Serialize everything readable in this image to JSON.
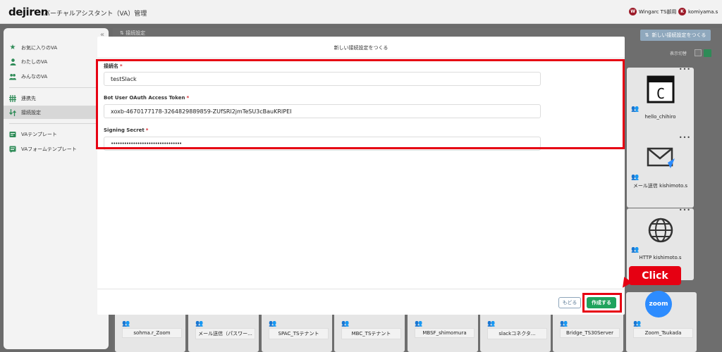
{
  "header": {
    "logo": "dejiren",
    "title": "バーチャルアシスタント（VA）管理",
    "tenant_badge": "W",
    "tenant_name": "Wingarc TS部用",
    "user_badge": "K",
    "user_name": "komiyama.s"
  },
  "sidebar": {
    "items": [
      {
        "label": "お気に入りのVA",
        "icon": "star-icon"
      },
      {
        "label": "わたしのVA",
        "icon": "person-icon"
      },
      {
        "label": "みんなのVA",
        "icon": "people-icon"
      },
      {
        "label": "連携先",
        "icon": "link-icon"
      },
      {
        "label": "接続設定",
        "icon": "connection-icon"
      },
      {
        "label": "VAテンプレート",
        "icon": "template-icon"
      },
      {
        "label": "VAフォームテンプレート",
        "icon": "form-template-icon"
      }
    ],
    "active_index": 4
  },
  "main": {
    "breadcrumb": "接続設定",
    "new_button": "新しい接続設定をつくる",
    "view_toggle_label": "表示切替"
  },
  "cards_right": [
    {
      "name": "hello_chihiro",
      "icon": "terminal-icon"
    },
    {
      "name": "メール送信 kishimoto.s",
      "icon": "mail-icon"
    },
    {
      "name": "HTTP kishimoto.s",
      "icon": "globe-icon"
    }
  ],
  "cards_bottom": [
    {
      "name": "sohma.r_Zoom"
    },
    {
      "name": "メール送信（パスワー..."
    },
    {
      "name": "SPAC_TSテナント"
    },
    {
      "name": "MBC_TSテナント"
    },
    {
      "name": "MBSF_shimomura"
    },
    {
      "name": "slackコネクタ..."
    },
    {
      "name": "Bridge_TS30Server"
    },
    {
      "name": "Zoom_Tsukada"
    }
  ],
  "zoom_logo_text": "zoom",
  "modal": {
    "title": "新しい接続設定をつくる",
    "fields": [
      {
        "label": "接続名",
        "value": "testSlack"
      },
      {
        "label": "Bot User OAuth Access Token",
        "value": "xoxb-4670177178-3264829889859-ZUfSRl2jmTeSU3cBauKRIPEI"
      },
      {
        "label": "Signing Secret",
        "value": "••••••••••••••••••••••••••••••••"
      }
    ],
    "required_mark": "*",
    "back_button": "もどる",
    "create_button": "作成する"
  },
  "annotation": {
    "callout_text": "Click",
    "highlight_color": "#e60012"
  },
  "colors": {
    "accent_green": "#20a35d",
    "sidebar_icon_green": "#2e8b57",
    "zoom_blue": "#2d8cff"
  }
}
